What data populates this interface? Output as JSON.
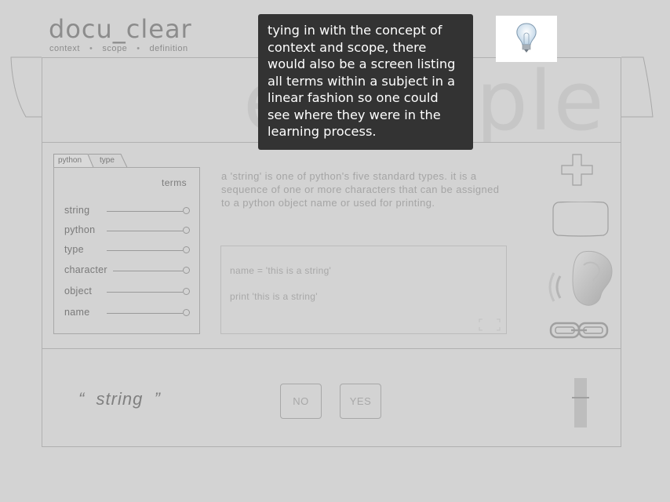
{
  "app": {
    "logo": "docu_clear",
    "logo_nav": [
      "context",
      "scope",
      "definition"
    ],
    "watermark": "example"
  },
  "tooltip": {
    "text": "tying in with the concept of context and scope, there would also be a screen listing all terms within a subject in a linear fashion so one could see where they were in the learning process."
  },
  "breadcrumb_tabs": [
    "python",
    "type"
  ],
  "terms_panel": {
    "title": "terms",
    "items": [
      "string",
      "python",
      "type",
      "character",
      "object",
      "name"
    ]
  },
  "definition": {
    "text": "a 'string' is one of python's five standard types.  it is a sequence of one or more characters that can be assigned to a python object name or used for printing."
  },
  "code_example": {
    "lines": [
      "name = 'this is a string'",
      "print 'this is a string'"
    ]
  },
  "quiz": {
    "word": "“  string  ”",
    "no_label": "NO",
    "yes_label": "YES"
  },
  "icons": {
    "hint": "lightbulb-icon",
    "add": "plus-icon",
    "screen": "screen-icon",
    "audio": "ear-sound-icon",
    "link": "chain-link-icon",
    "expand": "expand-icon"
  }
}
